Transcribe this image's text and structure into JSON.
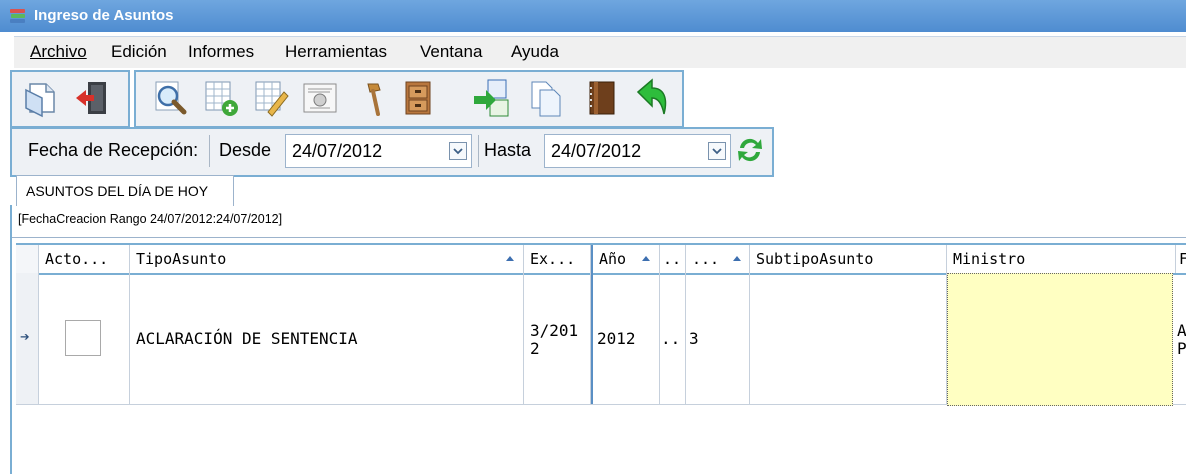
{
  "window": {
    "title": "Ingreso de Asuntos",
    "icon": "app-stack-icon"
  },
  "menu": [
    "Archivo",
    "Edición",
    "Informes",
    "Herramientas",
    "Ventana",
    "Ayuda"
  ],
  "toolbar": {
    "left_icons": [
      "open-document-icon",
      "exit-icon"
    ],
    "main_icons": [
      "search-icon",
      "add-grid-icon",
      "edit-grid-icon",
      "certificate-icon",
      "hammer-icon",
      "file-cabinet-icon",
      "export-excel-icon",
      "copy-icon",
      "book-icon",
      "back-arrow-icon"
    ]
  },
  "datebar": {
    "label": "Fecha de Recepción:",
    "desde_label": "Desde",
    "desde_value": "24/07/2012",
    "hasta_label": "Hasta",
    "hasta_value": "24/07/2012",
    "refresh_icon": "refresh-icon"
  },
  "tab": {
    "label": "ASUNTOS DEL DÍA DE HOY"
  },
  "filter_text": "[FechaCreacion Rango 24/07/2012:24/07/2012]",
  "grid": {
    "columns": [
      "Acto...",
      "TipoAsunto",
      "Ex...",
      "Año",
      "..",
      "...",
      "SubtipoAsunto",
      "Ministro",
      "F"
    ],
    "rows": [
      {
        "acto_checked": false,
        "tipo": "ACLARACIÓN DE SENTENCIA",
        "ex_line1": "3/201",
        "ex_line2": "2",
        "anio": "2012",
        "col5": "..",
        "col6": "3",
        "subtipo": "",
        "ministro": "",
        "f_line1": "A",
        "f_line2": "P"
      }
    ]
  },
  "colors": {
    "title_bar": "#5a96d6",
    "accent_border": "#7aaed3",
    "ministro_cell": "#ffffc2"
  }
}
